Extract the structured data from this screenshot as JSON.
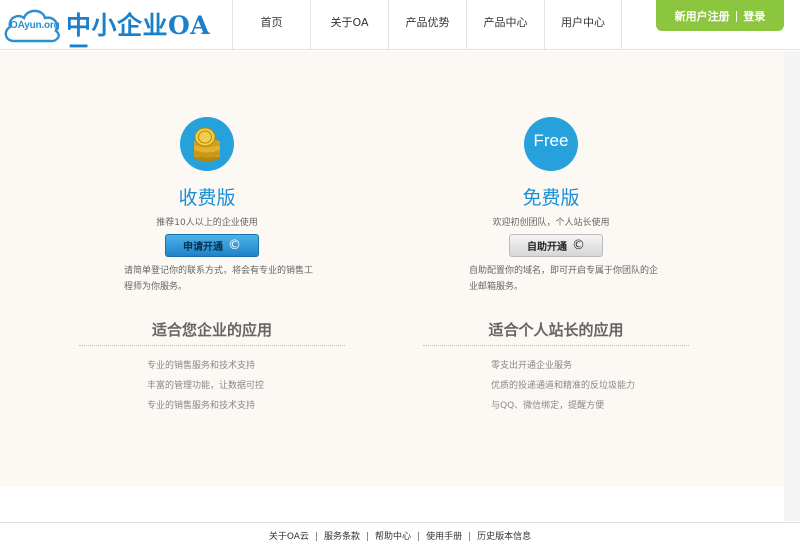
{
  "logo": {
    "cloud_text": "OAyun.org",
    "title": "中小企业OA云"
  },
  "nav": {
    "items": [
      {
        "label": "首页"
      },
      {
        "label": "关于OA"
      },
      {
        "label": "产品优势"
      },
      {
        "label": "产品中心"
      },
      {
        "label": "用户中心"
      }
    ]
  },
  "auth": {
    "register": "新用户注册",
    "separator": "|",
    "login": "登录"
  },
  "plans": {
    "paid": {
      "title": "收费版",
      "subtitle": "推荐10人以上的企业使用",
      "button": "申请开通",
      "button_icon": "©",
      "description": "请简单登记你的联系方式，将会有专业的销售工程师为你服务。",
      "section_title": "适合您企业的应用",
      "features": [
        "专业的销售服务和技术支持",
        "丰富的管理功能，让数据可控",
        "专业的销售服务和技术支持"
      ]
    },
    "free": {
      "icon_text": "Free",
      "title": "免费版",
      "subtitle": "欢迎初创团队，个人站长使用",
      "button": "自助开通",
      "button_icon": "©",
      "description": "自助配置你的域名，即可开启专属于你团队的企业邮箱服务。",
      "section_title": "适合个人站长的应用",
      "features": [
        "零支出开通企业服务",
        "优质的投递通道和精准的反垃圾能力",
        "与QQ、微信绑定，提醒方便"
      ]
    }
  },
  "footer": {
    "links": [
      "关于OA云",
      "服务条款",
      "帮助中心",
      "使用手册",
      "历史版本信息"
    ],
    "separator": "|"
  },
  "colors": {
    "brand_blue": "#1b8fd2",
    "accent_green": "#8cc63f",
    "panel_bg": "#fcf9f5"
  }
}
